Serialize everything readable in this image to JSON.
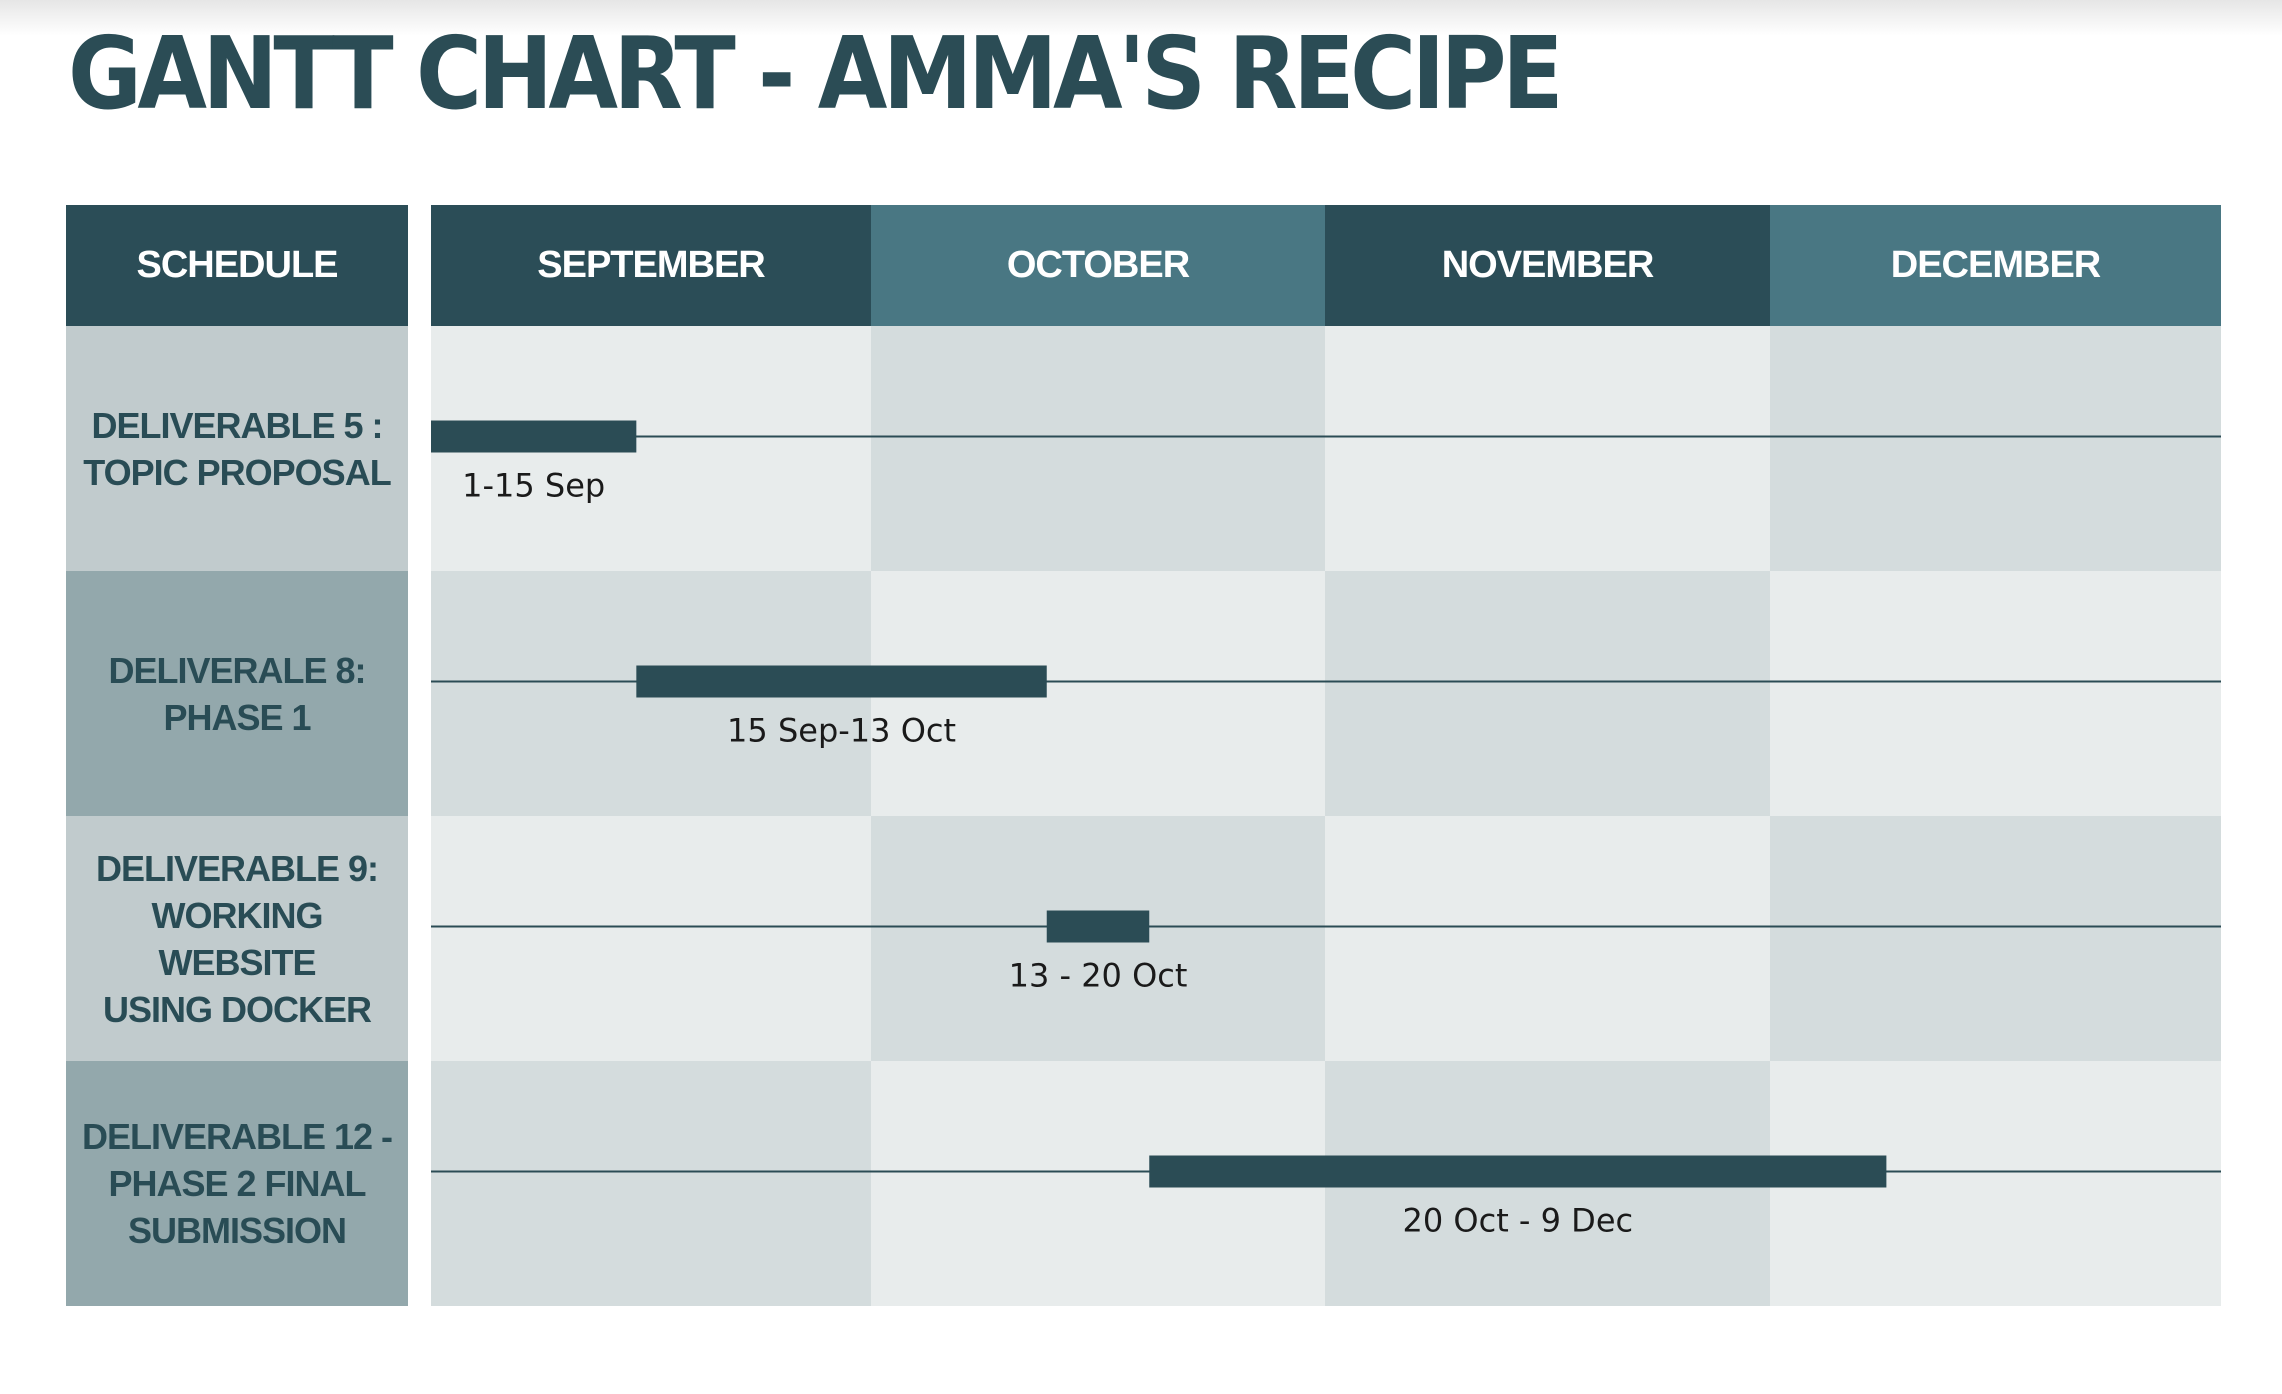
{
  "page": {
    "title": "GANTT CHART - AMMA'S RECIPE"
  },
  "colors": {
    "header_dark": "#2b4d57",
    "header_light": "#497783",
    "bar": "#2b4c55",
    "label_light": "#c1cbcd",
    "label_dark": "#93a8ac",
    "cell_light": "#e8ecec",
    "cell_mid": "#d4dcdd"
  },
  "chart_data": {
    "type": "gantt",
    "title": "GANTT CHART - AMMA'S RECIPE",
    "header_label": "SCHEDULE",
    "months": [
      "SEPTEMBER",
      "OCTOBER",
      "NOVEMBER",
      "DECEMBER"
    ],
    "month_days": [
      30,
      31,
      30,
      31
    ],
    "tasks": [
      {
        "label": "DELIVERABLE 5 :\nTOPIC PROPOSAL",
        "start": "09-01",
        "end": "09-15",
        "range_label": "1-15 Sep"
      },
      {
        "label": "DELIVERALE 8:\nPHASE 1",
        "start": "09-15",
        "end": "10-13",
        "range_label": "15 Sep-13 Oct"
      },
      {
        "label": "DELIVERABLE 9:\nWORKING WEBSITE\nUSING DOCKER",
        "start": "10-13",
        "end": "10-20",
        "range_label": "13 - 20 Oct"
      },
      {
        "label": "DELIVERABLE 12 -\nPHASE 2 FINAL\nSUBMISSION",
        "start": "10-20",
        "end": "12-09",
        "range_label": "20 Oct - 9 Dec"
      }
    ]
  }
}
